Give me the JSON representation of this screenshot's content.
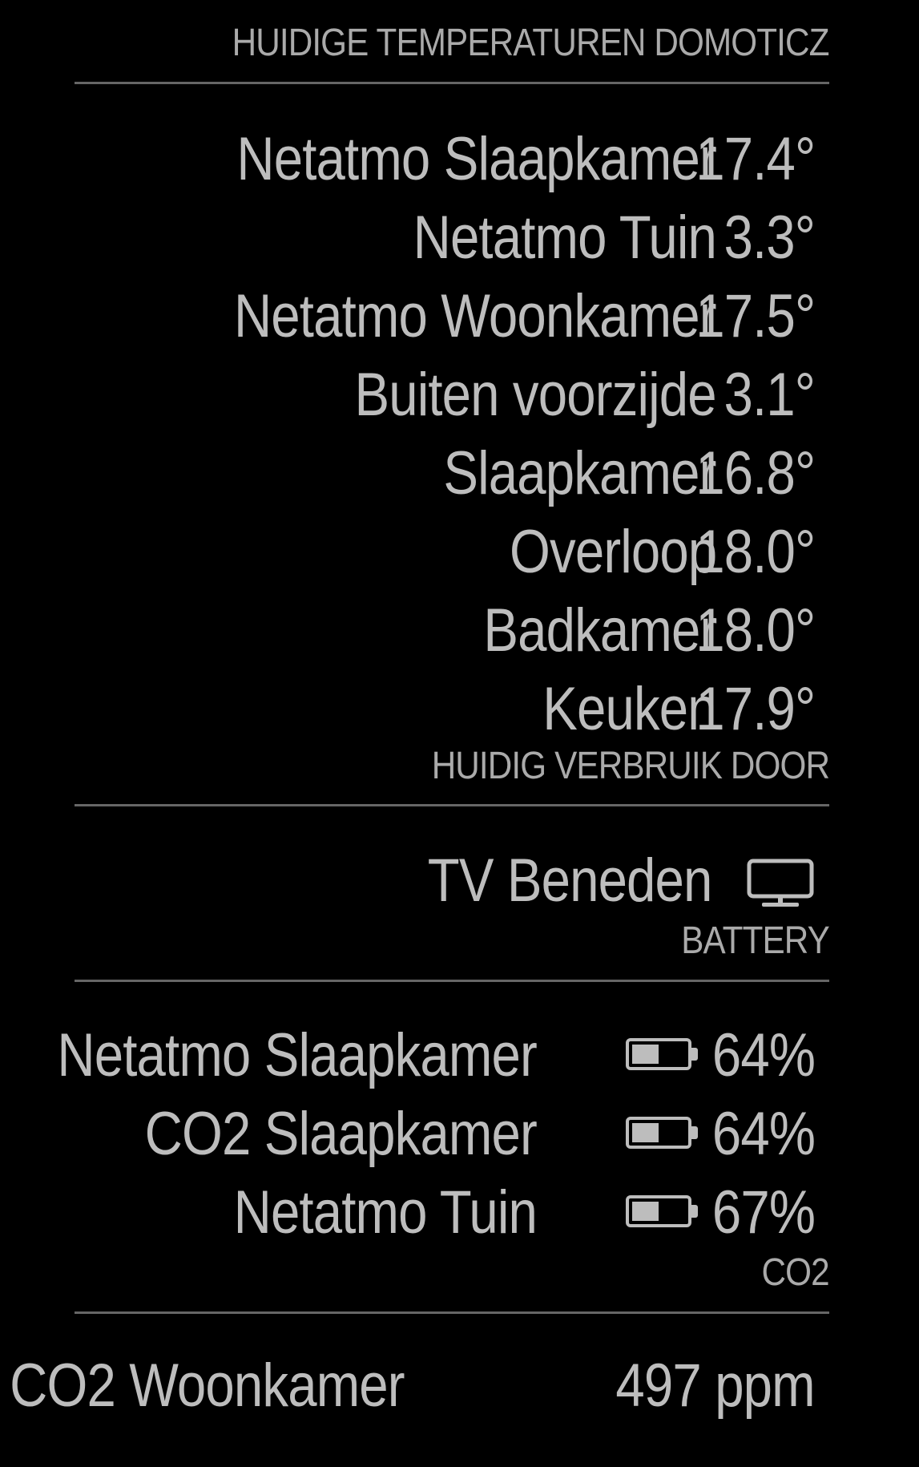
{
  "temperatures": {
    "header": "HUIDIGE TEMPERATUREN DOMOTICZ",
    "items": [
      {
        "name": "Netatmo Slaapkamer",
        "value": "17.4°"
      },
      {
        "name": "Netatmo Tuin",
        "value": "3.3°"
      },
      {
        "name": "Netatmo Woonkamer",
        "value": "17.5°"
      },
      {
        "name": "Buiten voorzijde",
        "value": "3.1°"
      },
      {
        "name": "Slaapkamer",
        "value": "16.8°"
      },
      {
        "name": "Overloop",
        "value": "18.0°"
      },
      {
        "name": "Badkamer",
        "value": "18.0°"
      },
      {
        "name": "Keuken",
        "value": "17.9°"
      }
    ]
  },
  "usage": {
    "header": "HUIDIG VERBRUIK DOOR",
    "items": [
      {
        "name": "TV Beneden",
        "icon": "tv-icon"
      }
    ]
  },
  "battery": {
    "header": "BATTERY",
    "items": [
      {
        "name": "Netatmo Slaapkamer",
        "value": "64%",
        "level": 0.64,
        "icon": "battery-half-icon"
      },
      {
        "name": "CO2 Slaapkamer",
        "value": "64%",
        "level": 0.64,
        "icon": "battery-half-icon"
      },
      {
        "name": "Netatmo Tuin",
        "value": "67%",
        "level": 0.67,
        "icon": "battery-half-icon"
      }
    ]
  },
  "co2": {
    "header": "CO2",
    "items": [
      {
        "name": "CO2 Woonkamer",
        "value": "497 ppm"
      }
    ]
  },
  "colors": {
    "background": "#000000",
    "text": "#bdbdbd",
    "header": "#aaaaaa",
    "divider": "#666666"
  }
}
